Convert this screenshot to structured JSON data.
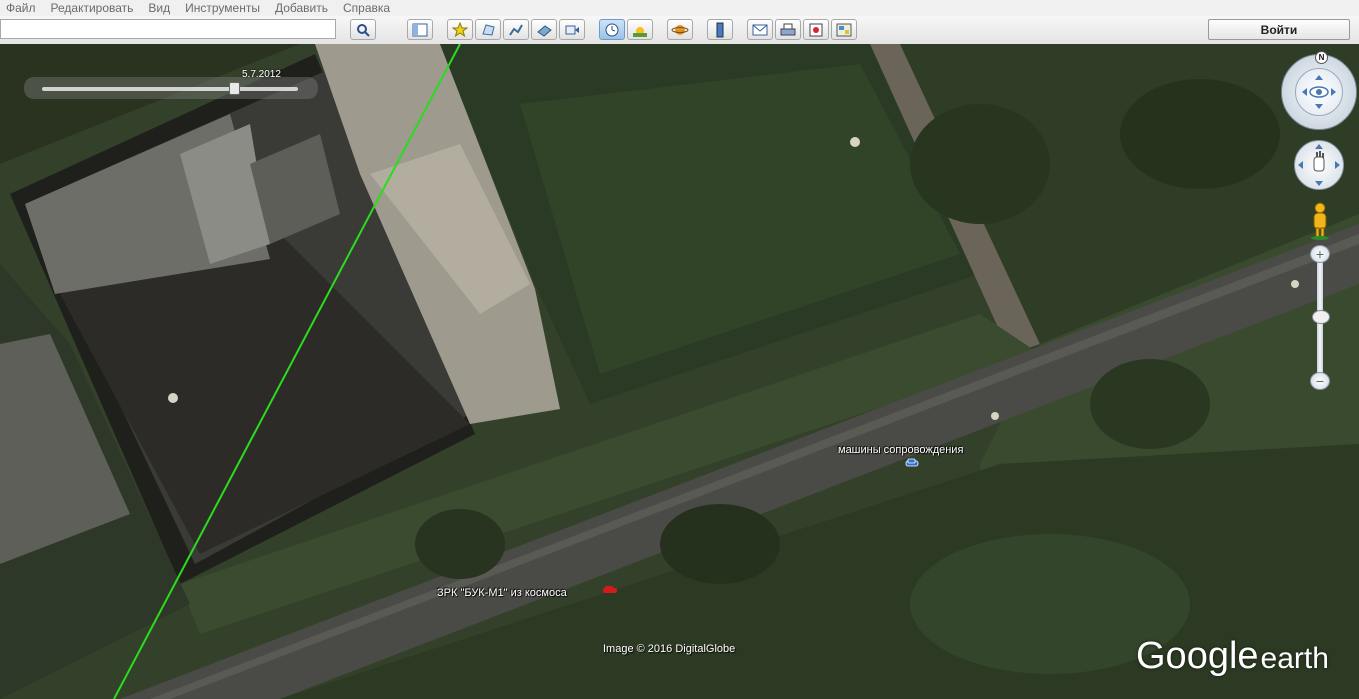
{
  "menu": [
    "Файл",
    "Редактировать",
    "Вид",
    "Инструменты",
    "Добавить",
    "Справка"
  ],
  "search": {
    "value": "",
    "icon": "search-icon"
  },
  "toolbar": {
    "login_label": "Войти",
    "buttons": [
      {
        "name": "sidebar-toggle-icon"
      },
      {
        "name": "add-placemark-icon"
      },
      {
        "name": "add-polygon-icon"
      },
      {
        "name": "add-path-icon"
      },
      {
        "name": "add-image-overlay-icon"
      },
      {
        "name": "record-tour-icon"
      },
      {
        "name": "historical-imagery-icon"
      },
      {
        "name": "sunlight-icon"
      },
      {
        "name": "planet-switch-icon"
      },
      {
        "name": "ruler-icon"
      },
      {
        "name": "email-icon"
      },
      {
        "name": "print-icon"
      },
      {
        "name": "save-image-icon"
      },
      {
        "name": "view-in-maps-icon"
      }
    ]
  },
  "timeslider": {
    "date": "5.7.2012",
    "position": 0.8
  },
  "placemarks": [
    {
      "label": "машины сопровождения",
      "icon": "car-icon",
      "color": "#2b6fd8"
    },
    {
      "label": "ЗРК \"БУК-М1\"  из космоса",
      "icon": "car-icon",
      "color": "#d21b1b"
    }
  ],
  "credit": "Image © 2016 DigitalGlobe",
  "logo": {
    "google": "Google",
    "earth": "earth"
  },
  "navigation": {
    "north_label": "N",
    "zoom_level": 0.45
  },
  "colors": {
    "path_line": "#2bdc1e",
    "toolbar_active": "#9cc3e8"
  }
}
